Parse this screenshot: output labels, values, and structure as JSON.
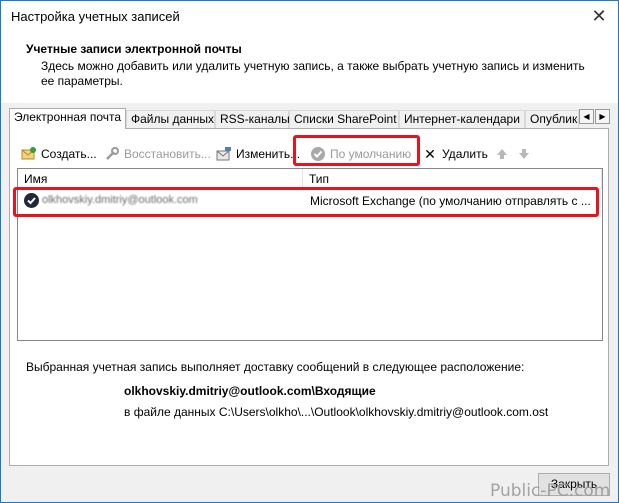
{
  "window": {
    "title": "Настройка учетных записей",
    "close_glyph": "✕"
  },
  "header": {
    "title": "Учетные записи электронной почты",
    "description": "Здесь можно добавить или удалить учетную запись, а также выбрать учетную запись и изменить ее параметры."
  },
  "tabs": [
    {
      "label": "Электронная почта",
      "active": true
    },
    {
      "label": "Файлы данных"
    },
    {
      "label": "RSS-каналы"
    },
    {
      "label": "Списки SharePoint"
    },
    {
      "label": "Интернет-календари"
    },
    {
      "label": "Опублико"
    }
  ],
  "tab_arrows": {
    "left": "◀",
    "right": "▶"
  },
  "toolbar": {
    "create": "Создать...",
    "restore": "Восстановить...",
    "change": "Изменить...",
    "default": "По умолчанию",
    "delete": "Удалить",
    "delete_glyph": "✕",
    "up_glyph": "🡅",
    "down_glyph": "🡇"
  },
  "list": {
    "col_name": "Имя",
    "col_type": "Тип",
    "rows": [
      {
        "name": "olkhovskiy.dmitriy@outlook.com",
        "type": "Microsoft Exchange (по умолчанию отправлять с ..."
      }
    ]
  },
  "info": {
    "line1": "Выбранная учетная запись выполняет доставку сообщений в следующее расположение:",
    "line2": "olkhovskiy.dmitriy@outlook.com\\Входящие",
    "line3": "в файле данных C:\\Users\\olkho\\...\\Outlook\\olkhovskiy.dmitriy@outlook.com.ost"
  },
  "close_button": "Закрыть",
  "watermark": "Public-PC.com",
  "colors": {
    "highlight": "#e8131c",
    "window_border": "#1979ca"
  }
}
